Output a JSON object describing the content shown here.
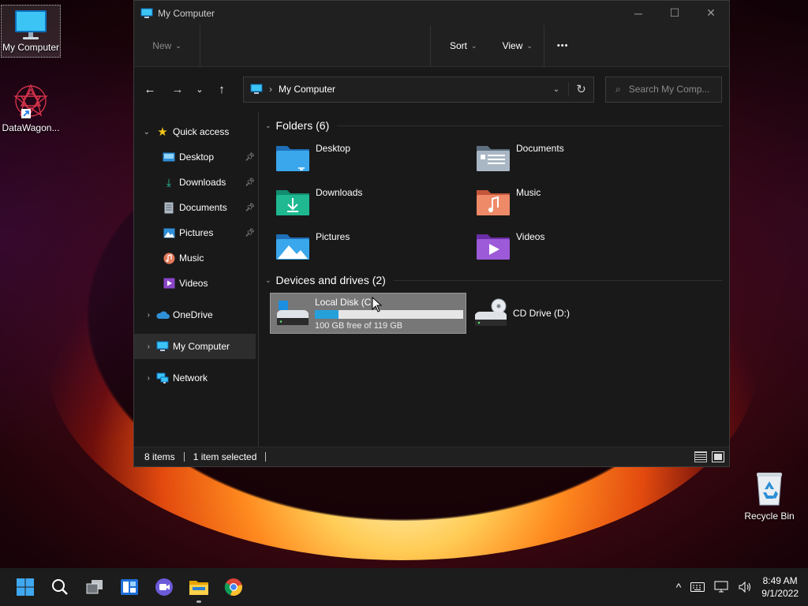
{
  "desktop": {
    "icons": [
      {
        "label": "My Computer"
      },
      {
        "label": "DataWagon..."
      },
      {
        "label": "Recycle Bin"
      }
    ]
  },
  "window": {
    "title": "My Computer",
    "minimize": "─",
    "maximize": "☐",
    "close": "✕",
    "commands": {
      "new_label": "New",
      "sort_label": "Sort",
      "view_label": "View",
      "more_label": "•••"
    },
    "address": {
      "path": "My Computer",
      "search_placeholder": "Search My Comp..."
    },
    "nav": {
      "quick_access": "Quick access",
      "items": [
        {
          "label": "Desktop",
          "pinned": true
        },
        {
          "label": "Downloads",
          "pinned": true
        },
        {
          "label": "Documents",
          "pinned": true
        },
        {
          "label": "Pictures",
          "pinned": true
        },
        {
          "label": "Music",
          "pinned": false
        },
        {
          "label": "Videos",
          "pinned": false
        }
      ],
      "onedrive": "OneDrive",
      "my_computer": "My Computer",
      "network": "Network"
    },
    "folders": {
      "header": "Folders (6)",
      "items": [
        {
          "name": "Desktop"
        },
        {
          "name": "Documents"
        },
        {
          "name": "Downloads"
        },
        {
          "name": "Music"
        },
        {
          "name": "Pictures"
        },
        {
          "name": "Videos"
        }
      ]
    },
    "drives": {
      "header": "Devices and drives (2)",
      "local": {
        "name": "Local Disk (C:)",
        "free": "100 GB free of 119 GB",
        "used_fraction": 0.16
      },
      "cd": {
        "name": "CD Drive (D:)"
      }
    },
    "status": {
      "items": "8 items",
      "selected": "1 item selected"
    }
  },
  "taskbar": {
    "time": "8:49 AM",
    "date": "9/1/2022"
  },
  "colors": {
    "accent": "#26a0da",
    "folder_blue": "#2f8fd8",
    "folder_teal": "#1fa98a",
    "music_orange": "#e3795a",
    "videos_purple": "#8a45c8"
  }
}
